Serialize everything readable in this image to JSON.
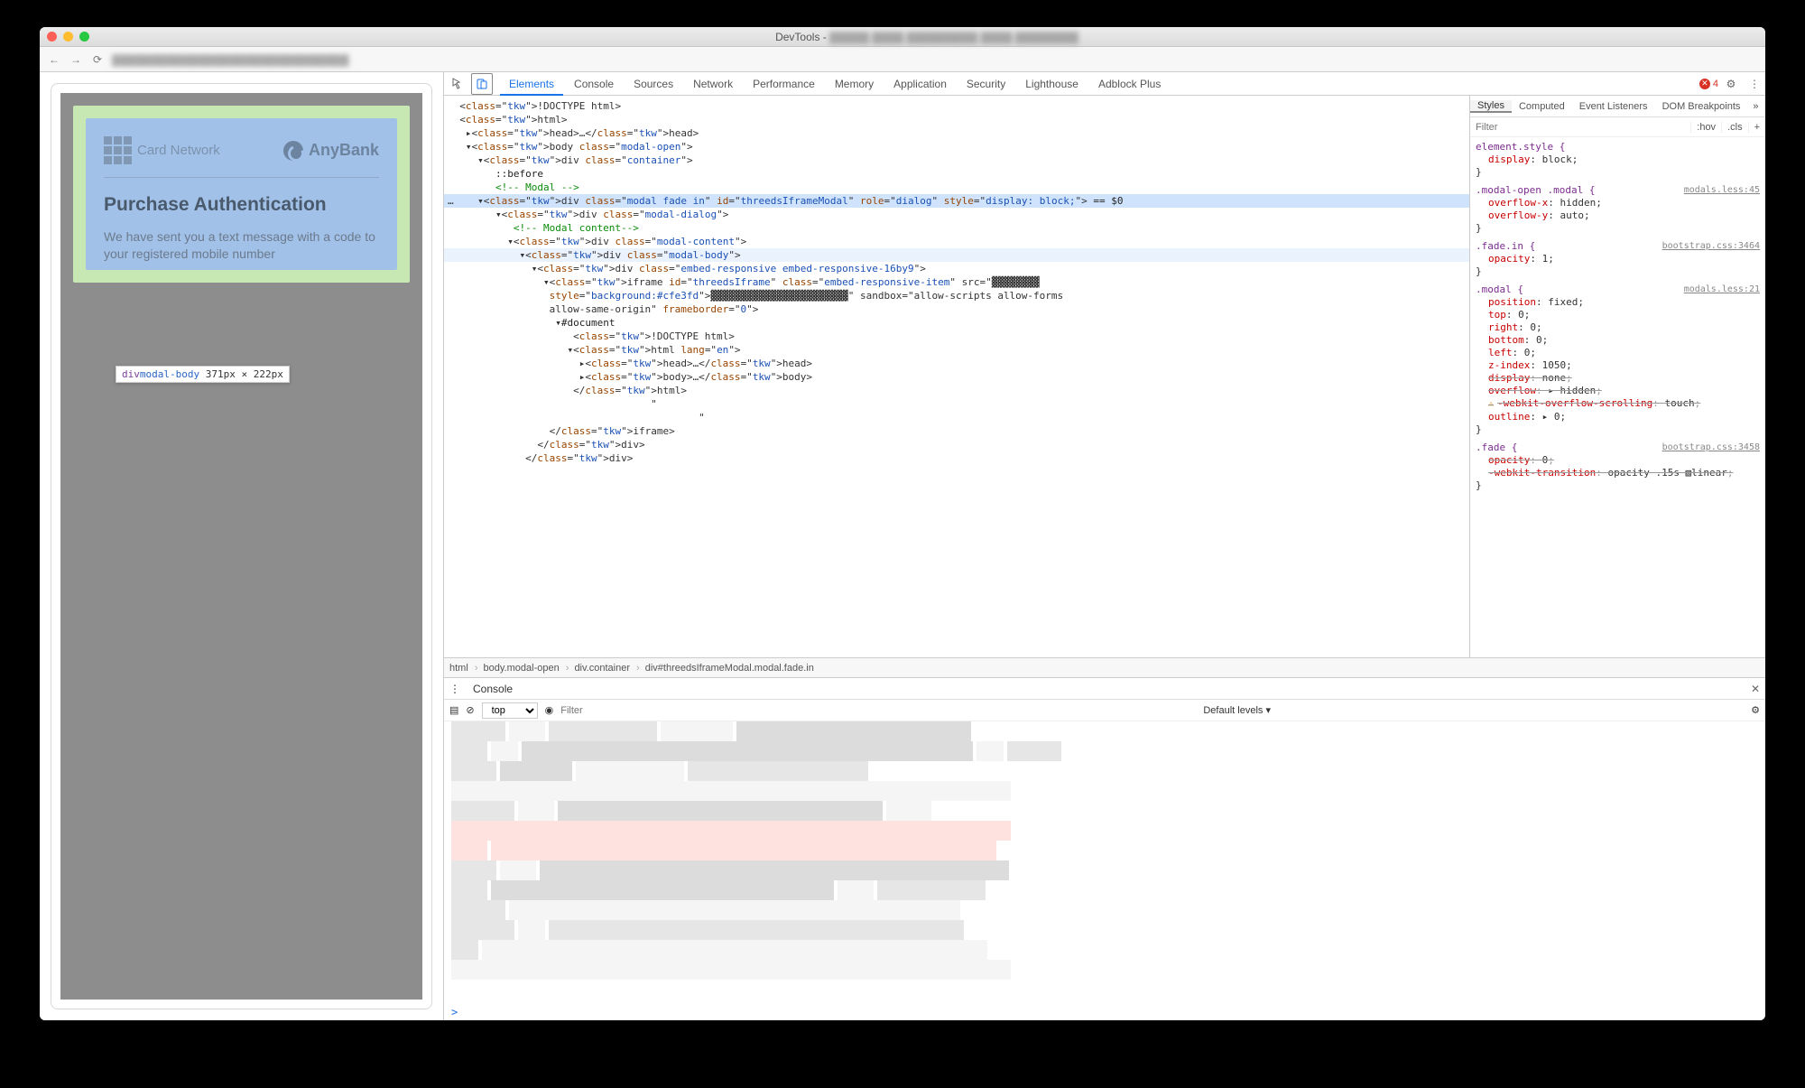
{
  "window": {
    "title_prefix": "DevTools - "
  },
  "toolbar": {
    "back": "←",
    "fwd": "→",
    "reload": "⟳"
  },
  "devtools": {
    "tabs": [
      "Elements",
      "Console",
      "Sources",
      "Network",
      "Performance",
      "Memory",
      "Application",
      "Security",
      "Lighthouse",
      "Adblock Plus"
    ],
    "active_tab": "Elements",
    "error_count": "4"
  },
  "dom": {
    "lines": [
      {
        "i": 1,
        "h": "  <!DOCTYPE html>",
        "cls": ""
      },
      {
        "i": 1,
        "h": "  <html>",
        "cls": ""
      },
      {
        "i": 2,
        "h": "   ▸<head>…</head>",
        "cls": ""
      },
      {
        "i": 2,
        "h": "   ▾<body class=\"modal-open\">",
        "cls": ""
      },
      {
        "i": 3,
        "h": "     ▾<div class=\"container\">",
        "cls": ""
      },
      {
        "i": 4,
        "h": "        ::before",
        "cls": ""
      },
      {
        "i": 4,
        "h": "        <!-- Modal -->",
        "cls": "",
        "cmt": true
      },
      {
        "i": 4,
        "h": "…    ▾<div class=\"modal fade in\" id=\"threedsIframeModal\" role=\"dialog\" style=\"display: block;\"> == $0",
        "cls": "hl-sel"
      },
      {
        "i": 5,
        "h": "        ▾<div class=\"modal-dialog\">",
        "cls": ""
      },
      {
        "i": 6,
        "h": "           <!-- Modal content-->",
        "cls": "",
        "cmt": true
      },
      {
        "i": 6,
        "h": "          ▾<div class=\"modal-content\">",
        "cls": ""
      },
      {
        "i": 7,
        "h": "            ▾<div class=\"modal-body\">",
        "cls": "hl-soft"
      },
      {
        "i": 8,
        "h": "              ▾<div class=\"embed-responsive embed-responsive-16by9\">",
        "cls": ""
      },
      {
        "i": 9,
        "h": "                ▾<iframe id=\"threedsIframe\" class=\"embed-responsive-item\" src=\"▓▓▓▓▓▓▓▓",
        "cls": ""
      },
      {
        "i": 9,
        "h": "                 ▓▓▓▓▓▓▓▓▓▓▓▓▓▓▓▓▓▓▓▓▓▓▓\" sandbox=\"allow-scripts allow-forms",
        "cls": "",
        "hlsrc": true
      },
      {
        "i": 9,
        "h": "                 allow-same-origin\" frameborder=\"0\">",
        "cls": ""
      },
      {
        "i": 10,
        "h": "                  ▾#document",
        "cls": ""
      },
      {
        "i": 11,
        "h": "                     <!DOCTYPE html>",
        "cls": ""
      },
      {
        "i": 11,
        "h": "                    ▾<html lang=\"en\">",
        "cls": ""
      },
      {
        "i": 12,
        "h": "                      ▸<head>…</head>",
        "cls": ""
      },
      {
        "i": 12,
        "h": "                      ▸<body>…</body>",
        "cls": ""
      },
      {
        "i": 11,
        "h": "                     </html>",
        "cls": ""
      },
      {
        "i": 11,
        "h": "                                  \"",
        "cls": ""
      },
      {
        "i": 11,
        "h": "                                          \"",
        "cls": ""
      },
      {
        "i": 9,
        "h": "                 </iframe>",
        "cls": ""
      },
      {
        "i": 8,
        "h": "               </div>",
        "cls": ""
      },
      {
        "i": 7,
        "h": "             </div>",
        "cls": ""
      }
    ]
  },
  "breadcrumb": [
    "html",
    "body.modal-open",
    "div.container",
    "div#threedsIframeModal.modal.fade.in"
  ],
  "styles_panel": {
    "tabs": [
      "Styles",
      "Computed",
      "Event Listeners",
      "DOM Breakpoints"
    ],
    "active": "Styles",
    "filter_placeholder": "Filter",
    "hov": ":hov",
    "cls": ".cls",
    "plus": "+",
    "rules": [
      {
        "sel": "element.style {",
        "props": [
          [
            "display",
            "block"
          ]
        ],
        "src": ""
      },
      {
        "sel": ".modal-open .modal {",
        "props": [
          [
            "overflow-x",
            "hidden"
          ],
          [
            "overflow-y",
            "auto"
          ]
        ],
        "src": "modals.less:45"
      },
      {
        "sel": ".fade.in {",
        "props": [
          [
            "opacity",
            "1"
          ]
        ],
        "src": "bootstrap.css:3464"
      },
      {
        "sel": ".modal {",
        "props": [
          [
            "position",
            "fixed"
          ],
          [
            "top",
            "0"
          ],
          [
            "right",
            "0"
          ],
          [
            "bottom",
            "0"
          ],
          [
            "left",
            "0"
          ],
          [
            "z-index",
            "1050"
          ],
          [
            "display",
            "none",
            "strike"
          ],
          [
            "overflow",
            "▸ hidden",
            "strike"
          ],
          [
            "-webkit-overflow-scrolling",
            "touch",
            "strike warn"
          ],
          [
            "outline",
            "▸ 0"
          ]
        ],
        "src": "modals.less:21"
      },
      {
        "sel": ".fade {",
        "props": [
          [
            "opacity",
            "0",
            "strike"
          ],
          [
            "-webkit-transition",
            "opacity .15s ▧linear",
            "strike"
          ]
        ],
        "src": "bootstrap.css:3458"
      }
    ]
  },
  "page_preview": {
    "card_network": "Card Network",
    "bank": "AnyBank",
    "heading": "Purchase Authentication",
    "body": "We have sent you a text message with a code to your registered mobile number",
    "tooltip_a": "div",
    "tooltip_b": "modal-body",
    "tooltip_dims": "371px × 222px"
  },
  "console": {
    "tab": "Console",
    "context": "top",
    "levels": "Default levels ▾",
    "filter_placeholder": "Filter",
    "prompt": ">"
  }
}
